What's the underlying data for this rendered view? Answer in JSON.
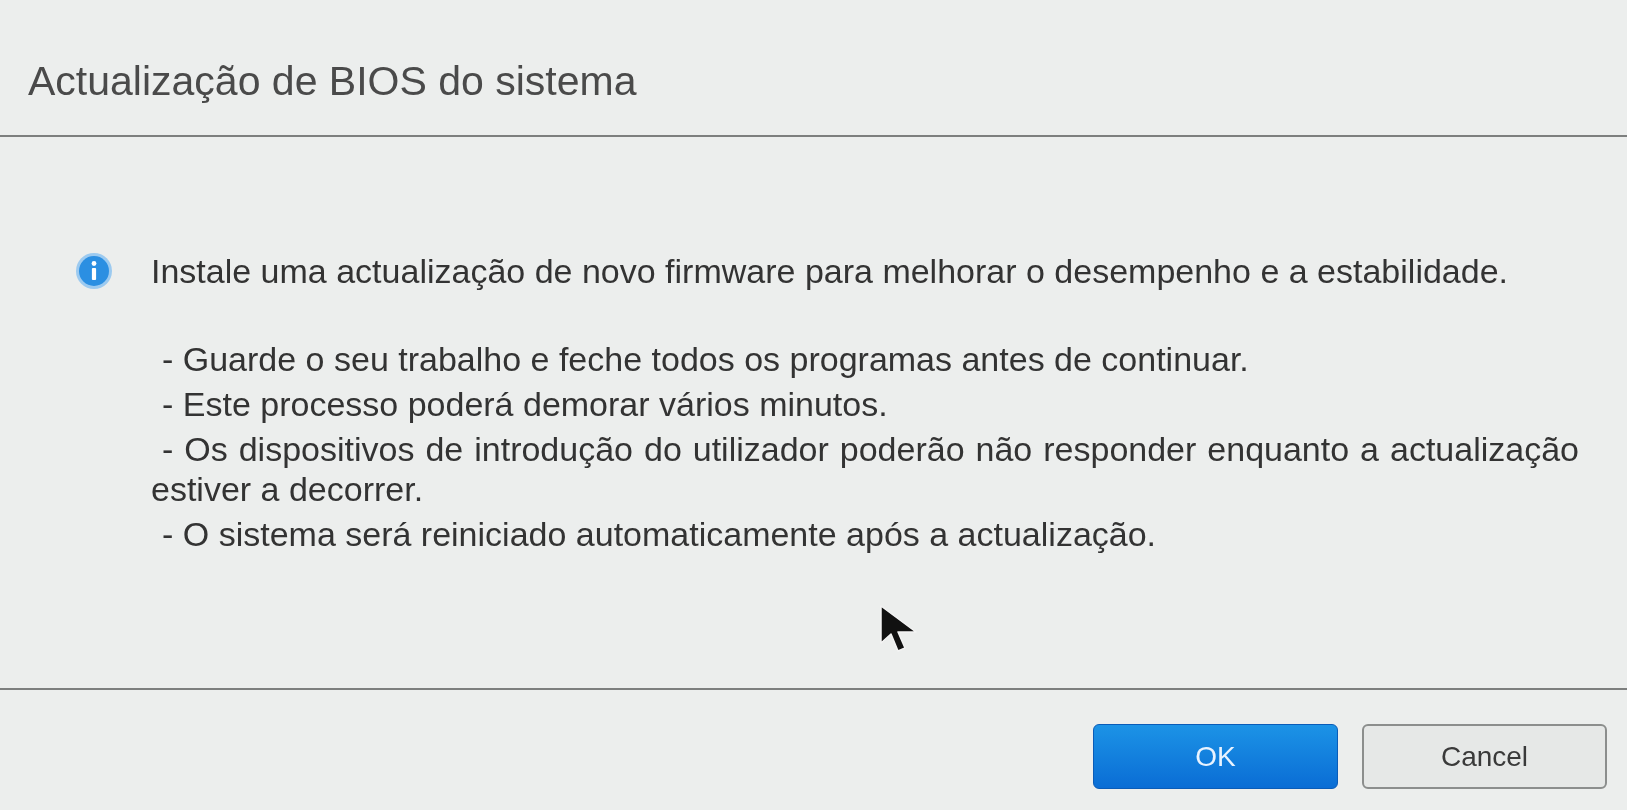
{
  "dialog": {
    "title": "Actualização de BIOS do sistema",
    "message": "Instale uma actualização de novo firmware para melhorar o desempenho e a estabilidade.",
    "notes": [
      "- Guarde o seu trabalho e feche todos os programas antes de continuar.",
      "- Este processo poderá demorar vários minutos.",
      "- Os dispositivos de introdução do utilizador poderão não responder enquanto a actualização estiver a decorrer.",
      "- O sistema será reiniciado automaticamente após a actualização."
    ],
    "buttons": [
      {
        "label": "OK",
        "kind": "primary"
      },
      {
        "label": "Cancel",
        "kind": "secondary"
      }
    ]
  }
}
